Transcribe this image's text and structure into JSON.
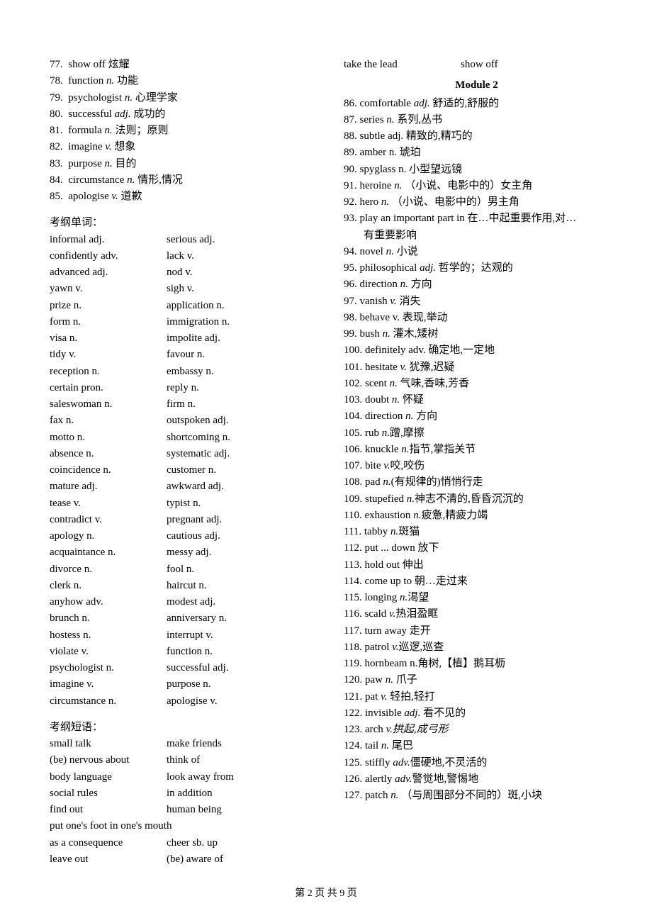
{
  "left": {
    "numbered": [
      {
        "n": "77.",
        "pre": "show off",
        "pos": "",
        "def": "炫耀"
      },
      {
        "n": "78.",
        "pre": "function",
        "pos": "n.",
        "def": "功能"
      },
      {
        "n": "79.",
        "pre": "psychologist",
        "pos": "n.",
        "def": "心理学家"
      },
      {
        "n": "80.",
        "pre": "successful",
        "pos": "adj.",
        "def": "成功的"
      },
      {
        "n": "81.",
        "pre": "formula",
        "pos": "n.",
        "def": "法则；原则"
      },
      {
        "n": "82.",
        "pre": "imagine",
        "pos": "v.",
        "def": "想象"
      },
      {
        "n": "83.",
        "pre": "purpose",
        "pos": "n.",
        "def": "目的"
      },
      {
        "n": "84.",
        "pre": "circumstance",
        "pos": "n.",
        "def": "情形,情况"
      },
      {
        "n": "85.",
        "pre": "apologise",
        "pos": "v.",
        "def": "道歉"
      }
    ],
    "kaogang_label": "考纲单词：",
    "pairs": [
      [
        "informal adj.",
        "serious adj."
      ],
      [
        "confidently adv.",
        "lack v."
      ],
      [
        "advanced adj.",
        "nod v."
      ],
      [
        "yawn v.",
        "sigh v."
      ],
      [
        "prize n.",
        "application n."
      ],
      [
        "form n.",
        "immigration n."
      ],
      [
        "visa n.",
        "impolite adj."
      ],
      [
        "tidy v.",
        "favour n."
      ],
      [
        "reception n.",
        "embassy n."
      ],
      [
        "certain pron.",
        "reply n."
      ],
      [
        "saleswoman n.",
        "firm n."
      ],
      [
        "fax n.",
        "outspoken adj."
      ],
      [
        "motto n.",
        "shortcoming n."
      ],
      [
        "absence n.",
        "systematic adj."
      ],
      [
        "coincidence n.",
        "customer n."
      ],
      [
        "mature adj.",
        "awkward adj."
      ],
      [
        "tease v.",
        "typist n."
      ],
      [
        "contradict v.",
        "pregnant adj."
      ],
      [
        "apology n.",
        "cautious adj."
      ],
      [
        "acquaintance n.",
        "messy adj."
      ],
      [
        "divorce n.",
        "fool n."
      ],
      [
        "clerk n.",
        "haircut n."
      ],
      [
        "anyhow adv.",
        "modest adj."
      ],
      [
        "brunch n.",
        "anniversary n."
      ],
      [
        "hostess n.",
        "interrupt v."
      ],
      [
        "violate v.",
        "function n."
      ],
      [
        "psychologist n.",
        "successful adj."
      ],
      [
        "imagine v.",
        "purpose n."
      ],
      [
        "circumstance n.",
        "apologise v."
      ]
    ],
    "phrases_label": "考纲短语：",
    "phrases": [
      [
        "small talk",
        "make friends"
      ],
      [
        "(be) nervous about",
        "think of"
      ],
      [
        "body language",
        "look away from"
      ],
      [
        "social rules",
        "in addition"
      ],
      [
        "find out",
        "human being"
      ]
    ],
    "phrases_single": [
      "put one's foot in one's mouth"
    ],
    "phrases_after": [
      [
        "as a consequence",
        "cheer sb. up"
      ],
      [
        "leave out",
        "(be) aware of"
      ]
    ]
  },
  "right": {
    "top_phrases": [
      "take the lead",
      "show off"
    ],
    "module_title": "Module 2",
    "numbered": [
      {
        "n": "86.",
        "pre": "comfortable",
        "pos": "adj.",
        "def": "舒适的,舒服的"
      },
      {
        "n": "87.",
        "pre": "series",
        "pos": "n.",
        "def": "系列,丛书"
      },
      {
        "n": "88.",
        "pre": "subtle adj.",
        "pos": "",
        "def": "精致的,精巧的"
      },
      {
        "n": "89.",
        "pre": "amber n.",
        "pos": "",
        "def": "琥珀"
      },
      {
        "n": "90.",
        "pre": "spyglass n.",
        "pos": "",
        "def": "小型望远镜"
      },
      {
        "n": "91.",
        "pre": "heroine",
        "pos": "n.",
        "def": "（小说、电影中的）女主角"
      },
      {
        "n": "92.",
        "pre": "hero",
        "pos": "n.",
        "def": "（小说、电影中的）男主角"
      },
      {
        "n": "93.",
        "pre": "play an important part in",
        "pos": "",
        "def": "在…中起重要作用,对…",
        "cont": "有重要影响"
      },
      {
        "n": "94.",
        "pre": "novel",
        "pos": "n.",
        "def": "小说"
      },
      {
        "n": "95.",
        "pre": "philosophical",
        "pos": "adj.",
        "def": "哲学的；达观的"
      },
      {
        "n": "96.",
        "pre": "direction",
        "pos": "n.",
        "def": "方向"
      },
      {
        "n": "97.",
        "pre": "vanish",
        "pos": "v.",
        "def": "消失"
      },
      {
        "n": "98.",
        "pre": "behave v.",
        "pos": "",
        "def": "表现,举动"
      },
      {
        "n": "99.",
        "pre": "bush",
        "pos": "n.",
        "def": "灌木,矮树"
      },
      {
        "n": "100.",
        "pre": "definitely adv.",
        "pos": "",
        "def": "确定地,一定地"
      },
      {
        "n": "101.",
        "pre": "hesitate",
        "pos": "v.",
        "def": "犹豫,迟疑"
      },
      {
        "n": "102.",
        "pre": "scent",
        "pos": "n.",
        "def": "气味,香味,芳香"
      },
      {
        "n": "103.",
        "pre": "doubt",
        "pos": "n.",
        "def": "怀疑"
      },
      {
        "n": "104.",
        "pre": "direction",
        "pos": "n.",
        "def": " 方向"
      },
      {
        "n": "105.",
        "pre": "rub",
        "pos": "n.",
        "def": "蹭,摩擦",
        "nospace": true
      },
      {
        "n": "106.",
        "pre": "knuckle",
        "pos": "n.",
        "def": "指节,掌指关节",
        "nospace": true
      },
      {
        "n": "107.",
        "pre": "bite",
        "pos": "v.",
        "def": "咬,咬伤",
        "nospace": true
      },
      {
        "n": "108.",
        "pre": "pad",
        "pos": "n.",
        "def": "(有规律的)悄悄行走",
        "nospace": true
      },
      {
        "n": "109.",
        "pre": "stupefied",
        "pos": "n.",
        "def": "神志不清的,昏昏沉沉的",
        "nospace": true
      },
      {
        "n": "110.",
        "pre": "exhaustion",
        "pos": "n.",
        "def": "疲惫,精疲力竭",
        "nospace": true
      },
      {
        "n": "111.",
        "pre": "tabby",
        "pos": "n.",
        "def": "斑猫",
        "nospace": true
      },
      {
        "n": "112.",
        "pre": "put ... down",
        "pos": "",
        "def": "放下"
      },
      {
        "n": "113.",
        "pre": "hold out",
        "pos": "",
        "def": "伸出"
      },
      {
        "n": "114.",
        "pre": "come up to",
        "pos": "",
        "def": "朝…走过来"
      },
      {
        "n": "115.",
        "pre": "longing",
        "pos": "n.",
        "def": "渴望",
        "nospace": true
      },
      {
        "n": "116.",
        "pre": "scald",
        "pos": "v.",
        "def": "热泪盈眶",
        "nospace": true
      },
      {
        "n": "117.",
        "pre": "turn away",
        "pos": "",
        "def": "走开"
      },
      {
        "n": "118.",
        "pre": "patrol",
        "pos": "v.",
        "def": "巡逻,巡查",
        "nospace": true
      },
      {
        "n": "119.",
        "pre": "hornbeam n.角树,【植】鹅耳枥",
        "pos": "",
        "def": ""
      },
      {
        "n": "120.",
        "pre": "paw",
        "pos": "n.",
        "def": " 爪子"
      },
      {
        "n": "121.",
        "pre": "pat",
        "pos": "v.",
        "def": "轻拍,轻打"
      },
      {
        "n": "122.",
        "pre": "invisible",
        "pos": "adj.",
        "def": "看不见的"
      },
      {
        "n": "123.",
        "pre": "arch",
        "pos": "v.",
        "def": "拱起,成弓形",
        "nospace": true,
        "defitalic": true
      },
      {
        "n": "124.",
        "pre": "tail",
        "pos": "n.",
        "def": "尾巴"
      },
      {
        "n": "125.",
        "pre": "stiffly",
        "pos": "adv.",
        "def": "僵硬地,不灵活的",
        "nospace": true
      },
      {
        "n": "126.",
        "pre": "alertly",
        "pos": "adv.",
        "def": "警觉地,警惕地",
        "nospace": true
      },
      {
        "n": "127.",
        "pre": "patch",
        "pos": "n.",
        "def": "（与周围部分不同的）斑,小块"
      }
    ]
  },
  "footer": "第 2 页 共 9 页"
}
